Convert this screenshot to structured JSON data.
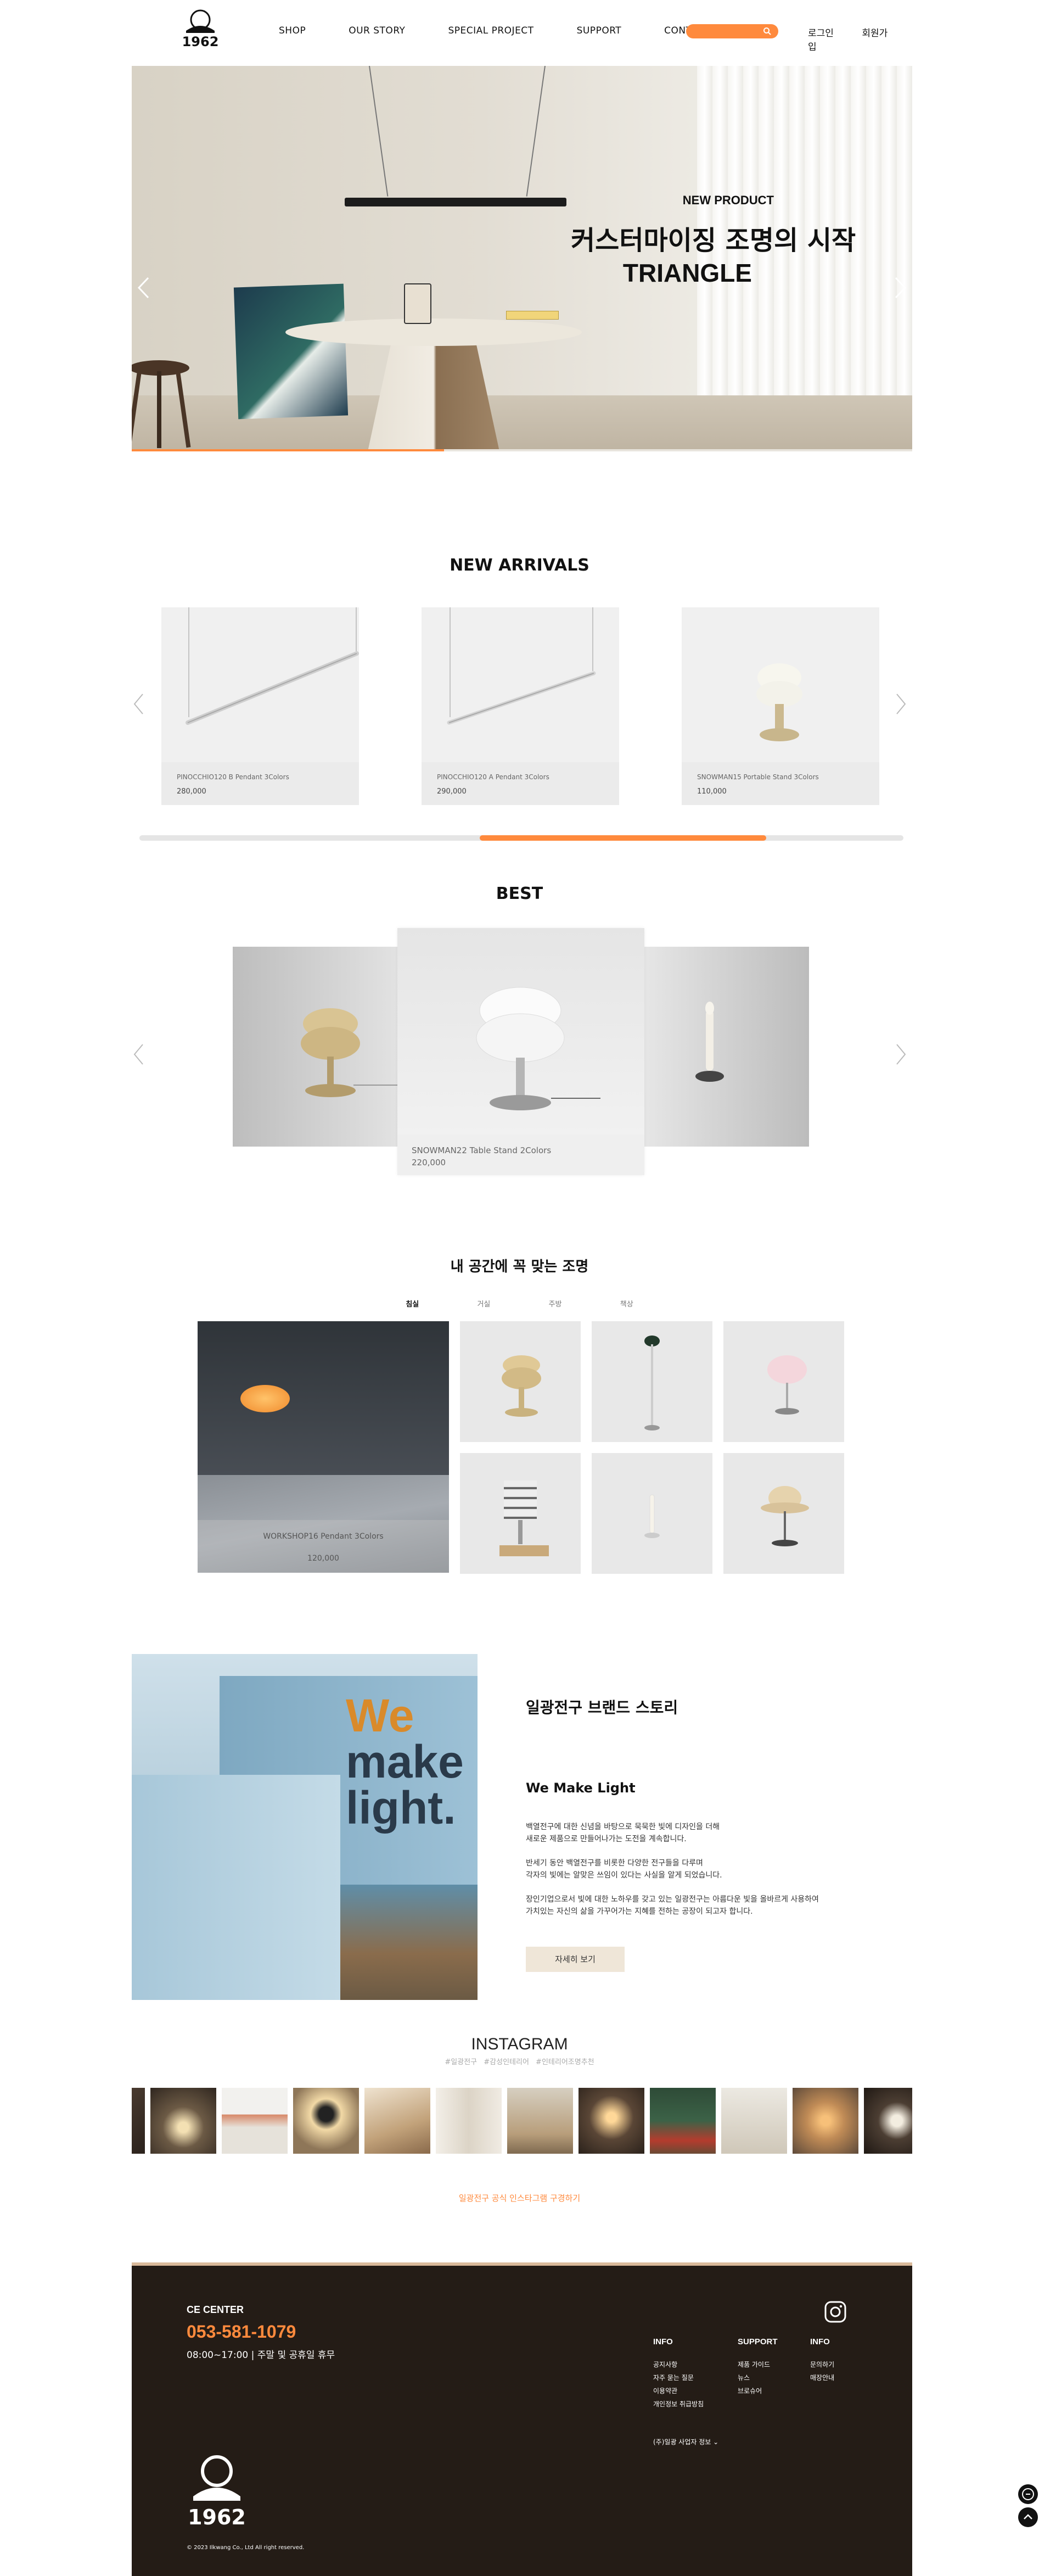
{
  "header": {
    "logo_text": "1962",
    "nav": [
      "SHOP",
      "OUR STORY",
      "SPECIAL PROJECT",
      "SUPPORT",
      "CONTACT"
    ],
    "login": "로그인",
    "signup": "회원가입"
  },
  "hero": {
    "kicker": "NEW PRODUCT",
    "title": "커스터마이징 조명의 시작",
    "subtitle": "TRIANGLE",
    "progress": 0.4
  },
  "new_arrivals": {
    "title": "NEW ARRIVALS",
    "items": [
      {
        "name": "PINOCCHIO120 B Pendant 3Colors",
        "price": "280,000"
      },
      {
        "name": "PINOCCHIO120 A Pendant 3Colors",
        "price": "290,000"
      },
      {
        "name": "SNOWMAN15 Portable Stand 3Colors",
        "price": "110,000"
      }
    ]
  },
  "best": {
    "title": "BEST",
    "featured": {
      "name": "SNOWMAN22 Table Stand 2Colors",
      "price": "220,000"
    }
  },
  "room": {
    "title": "내 공간에 꼭 맞는 조명",
    "tabs": [
      "침실",
      "거실",
      "주방",
      "책상"
    ],
    "active_tab": 0,
    "featured": {
      "name": "WORKSHOP16 Pendant 3Colors",
      "price": "120,000"
    }
  },
  "story": {
    "heading": "일광전구 브랜드 스토리",
    "slogan": [
      "We",
      "make",
      "light."
    ],
    "subheading": "We Make Light",
    "paragraphs": [
      [
        "백열전구에 대한 신념을 바탕으로 묵묵한 빛에 디자인을 더해",
        "새로운 제품으로 만들어나가는 도전을 계속합니다."
      ],
      [
        "반세기 동안 백열전구를 비롯한 다양한 전구들을 다루며",
        "각자의 빛에는 알맞은 쓰임이 있다는 사실을 알게 되었습니다."
      ],
      [
        "장인기업으로서 빛에 대한 노하우를 갖고 있는 일광전구는 아름다운 빛을 올바르게 사용하여",
        "가치있는 자신의 삶을 가꾸어가는 지혜를 전하는 공장이 되고자 합니다."
      ]
    ],
    "button": "자세히 보기"
  },
  "instagram": {
    "title": "INSTAGRAM",
    "tags": [
      "#일광전구",
      "#감성인테리어",
      "#인테리어조명추천"
    ],
    "link": "일광전구 공식 인스타그램 구경하기"
  },
  "footer": {
    "cs_label": "CE CENTER",
    "cs_phone": "053-581-1079",
    "cs_hours": "08:00~17:00 | 주말 및 공휴일 휴무",
    "columns": [
      {
        "title": "INFO",
        "items": [
          "공지사항",
          "자주 묻는 질문",
          "이용약관",
          "개인정보 취급방침"
        ]
      },
      {
        "title": "SUPPORT",
        "items": [
          "제품 가이드",
          "뉴스",
          "브로슈어"
        ]
      },
      {
        "title": "INFO",
        "items": [
          "문의하기",
          "매장안내"
        ]
      }
    ],
    "biz_info": "(주)일광 사업자 정보",
    "logo_text": "1962",
    "copyright": "© 2023 Ilkwang Co., Ltd All right reserved."
  },
  "colors": {
    "accent": "#ff8a3d",
    "footer_bg": "#241c16",
    "button_bg": "#efe6d8"
  }
}
